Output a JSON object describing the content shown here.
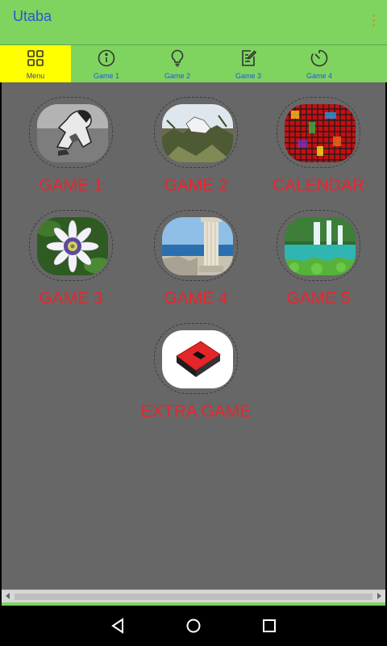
{
  "app": {
    "title": "Utaba"
  },
  "tabs": [
    {
      "label": "Menu",
      "icon": "grid-icon",
      "active": true
    },
    {
      "label": "Game 1",
      "icon": "info-icon",
      "active": false
    },
    {
      "label": "Game 2",
      "icon": "lightbulb-icon",
      "active": false
    },
    {
      "label": "Game 3",
      "icon": "edit-note-icon",
      "active": false
    },
    {
      "label": "Game 4",
      "icon": "timer-icon",
      "active": false
    }
  ],
  "tiles": [
    {
      "label": "GAME 1",
      "image": "graffiti-sitting-figure"
    },
    {
      "label": "GAME 2",
      "image": "rocky-landscape"
    },
    {
      "label": "CALENDAR",
      "image": "colorful-mosaic"
    },
    {
      "label": "GAME 3",
      "image": "passion-flower"
    },
    {
      "label": "GAME 4",
      "image": "greek-column-by-sea"
    },
    {
      "label": "GAME 5",
      "image": "waterfall-lake"
    },
    {
      "label": "EXTRA GAME",
      "image": "red-black-book"
    }
  ],
  "navigation": {
    "back": "back-icon",
    "home": "home-icon",
    "recents": "recents-icon"
  },
  "colors": {
    "appbar": "#7ed45f",
    "active_tab": "#ffff00",
    "title": "#2a55d6",
    "labels": "#e8262e",
    "background": "#676767"
  }
}
